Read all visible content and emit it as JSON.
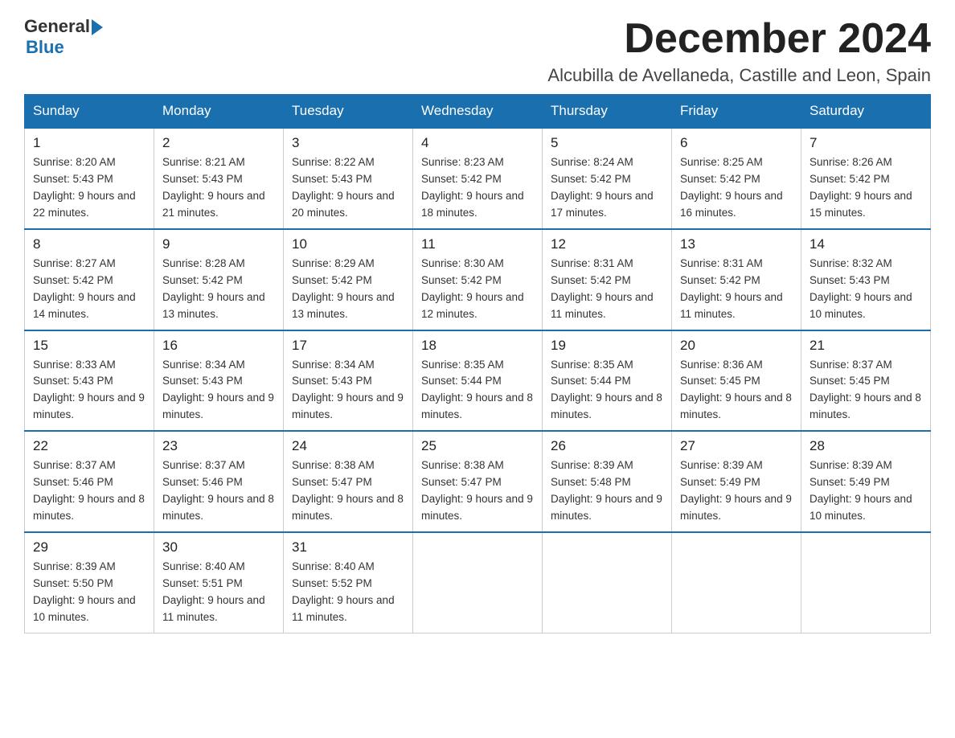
{
  "logo": {
    "general": "General",
    "triangle": "▶",
    "blue": "Blue"
  },
  "header": {
    "month": "December 2024",
    "location": "Alcubilla de Avellaneda, Castille and Leon, Spain"
  },
  "days_of_week": [
    "Sunday",
    "Monday",
    "Tuesday",
    "Wednesday",
    "Thursday",
    "Friday",
    "Saturday"
  ],
  "weeks": [
    [
      {
        "day": "1",
        "sunrise": "8:20 AM",
        "sunset": "5:43 PM",
        "daylight": "9 hours and 22 minutes."
      },
      {
        "day": "2",
        "sunrise": "8:21 AM",
        "sunset": "5:43 PM",
        "daylight": "9 hours and 21 minutes."
      },
      {
        "day": "3",
        "sunrise": "8:22 AM",
        "sunset": "5:43 PM",
        "daylight": "9 hours and 20 minutes."
      },
      {
        "day": "4",
        "sunrise": "8:23 AM",
        "sunset": "5:42 PM",
        "daylight": "9 hours and 18 minutes."
      },
      {
        "day": "5",
        "sunrise": "8:24 AM",
        "sunset": "5:42 PM",
        "daylight": "9 hours and 17 minutes."
      },
      {
        "day": "6",
        "sunrise": "8:25 AM",
        "sunset": "5:42 PM",
        "daylight": "9 hours and 16 minutes."
      },
      {
        "day": "7",
        "sunrise": "8:26 AM",
        "sunset": "5:42 PM",
        "daylight": "9 hours and 15 minutes."
      }
    ],
    [
      {
        "day": "8",
        "sunrise": "8:27 AM",
        "sunset": "5:42 PM",
        "daylight": "9 hours and 14 minutes."
      },
      {
        "day": "9",
        "sunrise": "8:28 AM",
        "sunset": "5:42 PM",
        "daylight": "9 hours and 13 minutes."
      },
      {
        "day": "10",
        "sunrise": "8:29 AM",
        "sunset": "5:42 PM",
        "daylight": "9 hours and 13 minutes."
      },
      {
        "day": "11",
        "sunrise": "8:30 AM",
        "sunset": "5:42 PM",
        "daylight": "9 hours and 12 minutes."
      },
      {
        "day": "12",
        "sunrise": "8:31 AM",
        "sunset": "5:42 PM",
        "daylight": "9 hours and 11 minutes."
      },
      {
        "day": "13",
        "sunrise": "8:31 AM",
        "sunset": "5:42 PM",
        "daylight": "9 hours and 11 minutes."
      },
      {
        "day": "14",
        "sunrise": "8:32 AM",
        "sunset": "5:43 PM",
        "daylight": "9 hours and 10 minutes."
      }
    ],
    [
      {
        "day": "15",
        "sunrise": "8:33 AM",
        "sunset": "5:43 PM",
        "daylight": "9 hours and 9 minutes."
      },
      {
        "day": "16",
        "sunrise": "8:34 AM",
        "sunset": "5:43 PM",
        "daylight": "9 hours and 9 minutes."
      },
      {
        "day": "17",
        "sunrise": "8:34 AM",
        "sunset": "5:43 PM",
        "daylight": "9 hours and 9 minutes."
      },
      {
        "day": "18",
        "sunrise": "8:35 AM",
        "sunset": "5:44 PM",
        "daylight": "9 hours and 8 minutes."
      },
      {
        "day": "19",
        "sunrise": "8:35 AM",
        "sunset": "5:44 PM",
        "daylight": "9 hours and 8 minutes."
      },
      {
        "day": "20",
        "sunrise": "8:36 AM",
        "sunset": "5:45 PM",
        "daylight": "9 hours and 8 minutes."
      },
      {
        "day": "21",
        "sunrise": "8:37 AM",
        "sunset": "5:45 PM",
        "daylight": "9 hours and 8 minutes."
      }
    ],
    [
      {
        "day": "22",
        "sunrise": "8:37 AM",
        "sunset": "5:46 PM",
        "daylight": "9 hours and 8 minutes."
      },
      {
        "day": "23",
        "sunrise": "8:37 AM",
        "sunset": "5:46 PM",
        "daylight": "9 hours and 8 minutes."
      },
      {
        "day": "24",
        "sunrise": "8:38 AM",
        "sunset": "5:47 PM",
        "daylight": "9 hours and 8 minutes."
      },
      {
        "day": "25",
        "sunrise": "8:38 AM",
        "sunset": "5:47 PM",
        "daylight": "9 hours and 9 minutes."
      },
      {
        "day": "26",
        "sunrise": "8:39 AM",
        "sunset": "5:48 PM",
        "daylight": "9 hours and 9 minutes."
      },
      {
        "day": "27",
        "sunrise": "8:39 AM",
        "sunset": "5:49 PM",
        "daylight": "9 hours and 9 minutes."
      },
      {
        "day": "28",
        "sunrise": "8:39 AM",
        "sunset": "5:49 PM",
        "daylight": "9 hours and 10 minutes."
      }
    ],
    [
      {
        "day": "29",
        "sunrise": "8:39 AM",
        "sunset": "5:50 PM",
        "daylight": "9 hours and 10 minutes."
      },
      {
        "day": "30",
        "sunrise": "8:40 AM",
        "sunset": "5:51 PM",
        "daylight": "9 hours and 11 minutes."
      },
      {
        "day": "31",
        "sunrise": "8:40 AM",
        "sunset": "5:52 PM",
        "daylight": "9 hours and 11 minutes."
      },
      null,
      null,
      null,
      null
    ]
  ]
}
